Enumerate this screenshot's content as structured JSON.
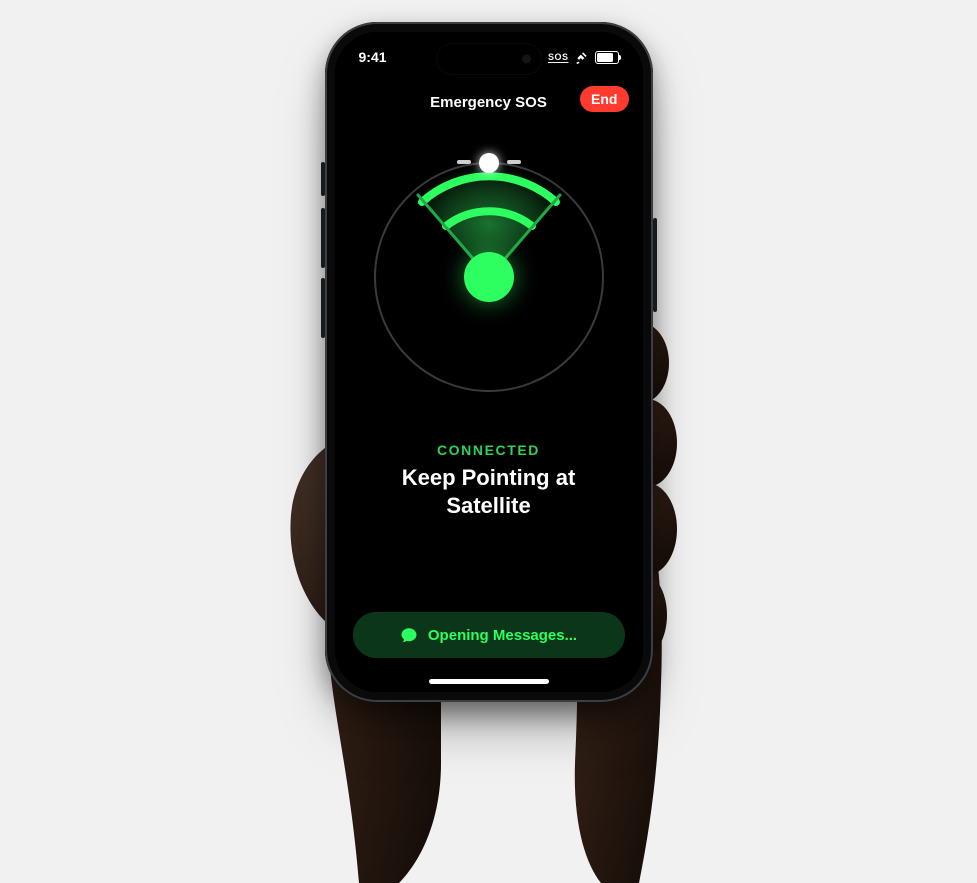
{
  "status_bar": {
    "time": "9:41",
    "sos_label": "SOS"
  },
  "nav": {
    "title": "Emergency SOS",
    "end_label": "End"
  },
  "status": {
    "connected_label": "CONNECTED",
    "instruction": "Keep Pointing at Satellite"
  },
  "messages_button": {
    "label": "Opening Messages..."
  },
  "colors": {
    "accent_green": "#30d158",
    "danger_red": "#ff3b30"
  }
}
